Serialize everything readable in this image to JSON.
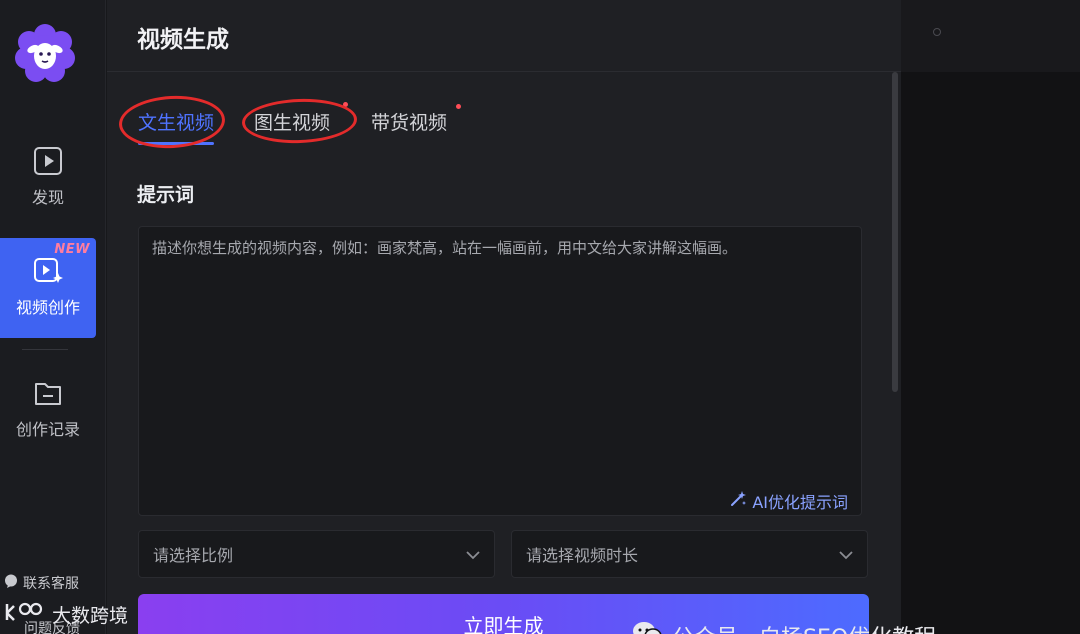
{
  "sidebar": {
    "items": [
      {
        "label": "发现",
        "icon": "play-square-icon"
      },
      {
        "label": "视频创作",
        "icon": "video-sparkle-icon",
        "badge": "NEW",
        "active": true
      },
      {
        "label": "创作记录",
        "icon": "folder-icon"
      }
    ],
    "support_label": "联系客服",
    "feedback_label": "问题反馈"
  },
  "header": {
    "title": "视频生成"
  },
  "tabs": [
    {
      "label": "文生视频",
      "active": true
    },
    {
      "label": "图生视频"
    },
    {
      "label": "带货视频"
    }
  ],
  "prompt": {
    "label": "提示词",
    "value": "",
    "placeholder": "描述你想生成的视频内容，例如：画家梵高，站在一幅画前，用中文给大家讲解这幅画。",
    "optimize_label": "AI优化提示词"
  },
  "options": {
    "ratio_placeholder": "请选择比例",
    "duration_placeholder": "请选择视频时长"
  },
  "generate_button": {
    "label": "立即生成"
  },
  "watermarks": {
    "left": "大数跨境",
    "right": "公众号 · 白杨SEO优化教程"
  },
  "colors": {
    "accent": "#4f73ff",
    "active_nav": "#3f63f2",
    "badge": "#ff7da0",
    "annotation": "#e32b2b",
    "button_gradient_start": "#8a3ff0",
    "button_gradient_end": "#4d6bff"
  }
}
